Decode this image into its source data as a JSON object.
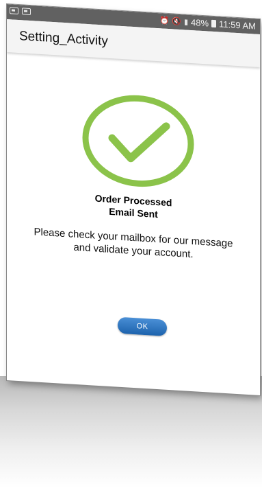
{
  "status_bar": {
    "battery": "48%",
    "time": "11:59 AM",
    "icons": [
      "notification-icon",
      "image-notification-icon",
      "alarm-icon",
      "mute-icon",
      "signal-icon",
      "battery-icon"
    ]
  },
  "app_bar": {
    "title": "Setting_Activity"
  },
  "dialog": {
    "icon": "check-circle-icon",
    "accent_color": "#8bc34a",
    "headline_line1": "Order Processed",
    "headline_line2": "Email Sent",
    "message_line1": "Please check your mailbox for our message",
    "message_line2": "and validate your account.",
    "ok_label": "OK",
    "ok_color": "#2a6fb8"
  }
}
